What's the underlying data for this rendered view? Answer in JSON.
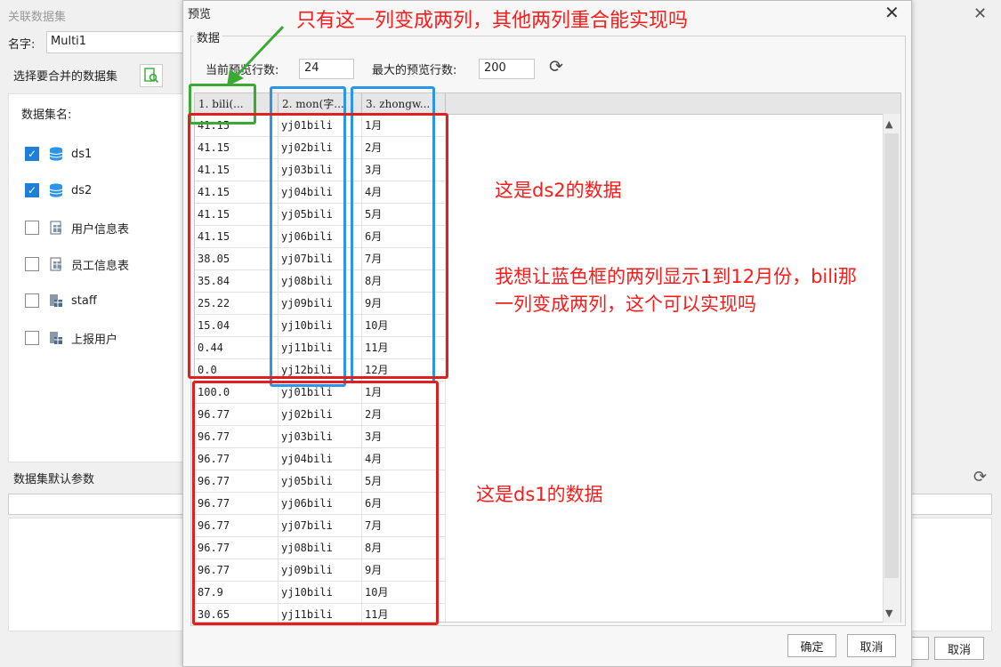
{
  "back_window": {
    "title": "关联数据集",
    "name_label": "名字:",
    "name_value": "Multi1",
    "select_label": "选择要合并的数据集",
    "list_title": "数据集名:",
    "datasets": [
      {
        "label": "ds1",
        "checked": true,
        "icon": "database-icon"
      },
      {
        "label": "ds2",
        "checked": true,
        "icon": "database-icon"
      },
      {
        "label": "用户信息表",
        "checked": false,
        "icon": "table-icon"
      },
      {
        "label": "员工信息表",
        "checked": false,
        "icon": "table-icon"
      },
      {
        "label": "staff",
        "checked": false,
        "icon": "server-table-icon"
      },
      {
        "label": "上报用户",
        "checked": false,
        "icon": "server-table-icon"
      }
    ],
    "params_label": "数据集默认参数",
    "cancel_label": "取消"
  },
  "preview": {
    "title": "预览",
    "group_label": "数据",
    "current_rows_label": "当前预览行数:",
    "current_rows_value": "24",
    "max_rows_label": "最大的预览行数:",
    "max_rows_value": "200",
    "columns": [
      "1. bili(...",
      "2. mon(字...",
      "3. zhongw..."
    ],
    "rows": [
      [
        "41.15",
        "yj01bili",
        "1月"
      ],
      [
        "41.15",
        "yj02bili",
        "2月"
      ],
      [
        "41.15",
        "yj03bili",
        "3月"
      ],
      [
        "41.15",
        "yj04bili",
        "4月"
      ],
      [
        "41.15",
        "yj05bili",
        "5月"
      ],
      [
        "41.15",
        "yj06bili",
        "6月"
      ],
      [
        "38.05",
        "yj07bili",
        "7月"
      ],
      [
        "35.84",
        "yj08bili",
        "8月"
      ],
      [
        "25.22",
        "yj09bili",
        "9月"
      ],
      [
        "15.04",
        "yj10bili",
        "10月"
      ],
      [
        "0.44",
        "yj11bili",
        "11月"
      ],
      [
        "0.0",
        "yj12bili",
        "12月"
      ],
      [
        "100.0",
        "yj01bili",
        "1月"
      ],
      [
        "96.77",
        "yj02bili",
        "2月"
      ],
      [
        "96.77",
        "yj03bili",
        "3月"
      ],
      [
        "96.77",
        "yj04bili",
        "4月"
      ],
      [
        "96.77",
        "yj05bili",
        "5月"
      ],
      [
        "96.77",
        "yj06bili",
        "6月"
      ],
      [
        "96.77",
        "yj07bili",
        "7月"
      ],
      [
        "96.77",
        "yj08bili",
        "8月"
      ],
      [
        "96.77",
        "yj09bili",
        "9月"
      ],
      [
        "87.9",
        "yj10bili",
        "10月"
      ],
      [
        "30.65",
        "yj11bili",
        "11月"
      ]
    ],
    "ok_label": "确定",
    "cancel_label": "取消"
  },
  "annotations": {
    "top_question": "只有这一列变成两列，其他两列重合能实现吗",
    "ds2_note": "这是ds2的数据",
    "want_note": "我想让蓝色框的两列显示1到12月份，bili那一列变成两列，这个可以实现吗",
    "ds1_note": "这是ds1的数据",
    "colors": {
      "green": "#3aaa35",
      "blue": "#2b95e8",
      "red": "#e02020",
      "text_red": "#ff1a1a"
    }
  }
}
